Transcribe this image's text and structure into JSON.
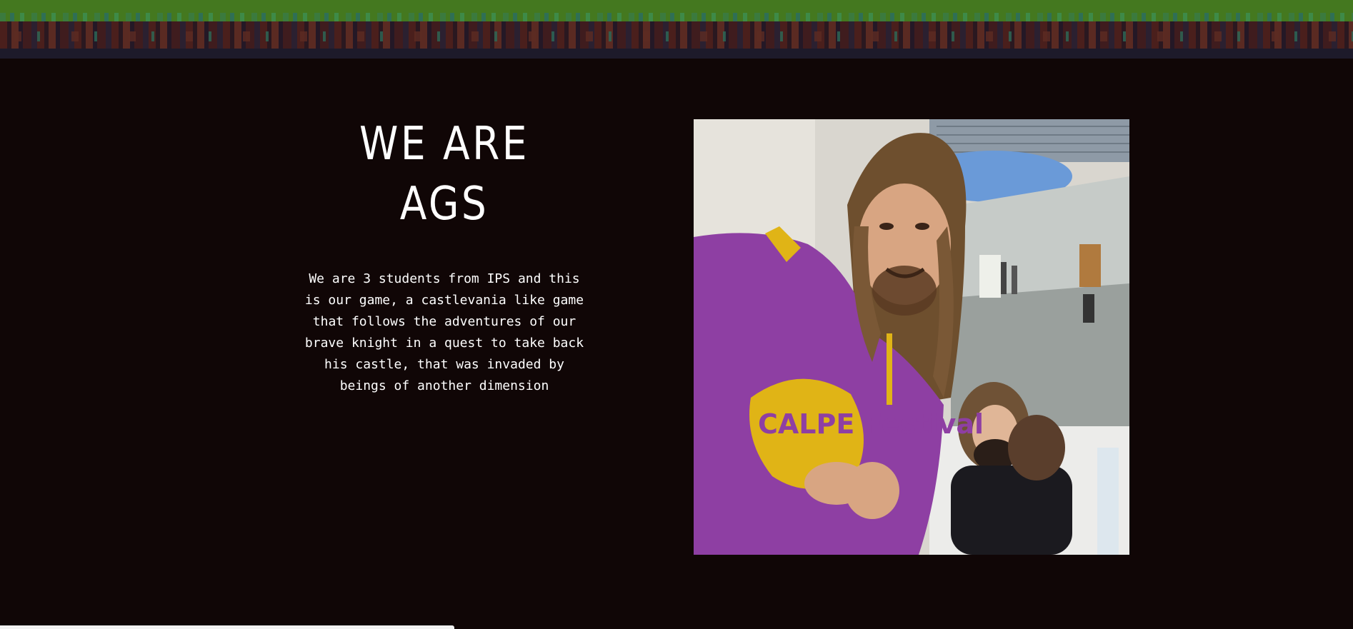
{
  "hero": {
    "title": "WE ARE AGS",
    "description": "We are 3 students from IPS and this is our game, a castlevania like game that follows the adventures of our brave knight in a quest to take back his castle, that was invaded by beings of another dimension"
  },
  "colors": {
    "background": "#100606",
    "text": "#ffffff",
    "grass": "#44781f",
    "hoodie": "#8e3fa3",
    "hoodie_print": "#e0b416"
  },
  "photo": {
    "hoodie_print_text": "CALPE Festival"
  }
}
